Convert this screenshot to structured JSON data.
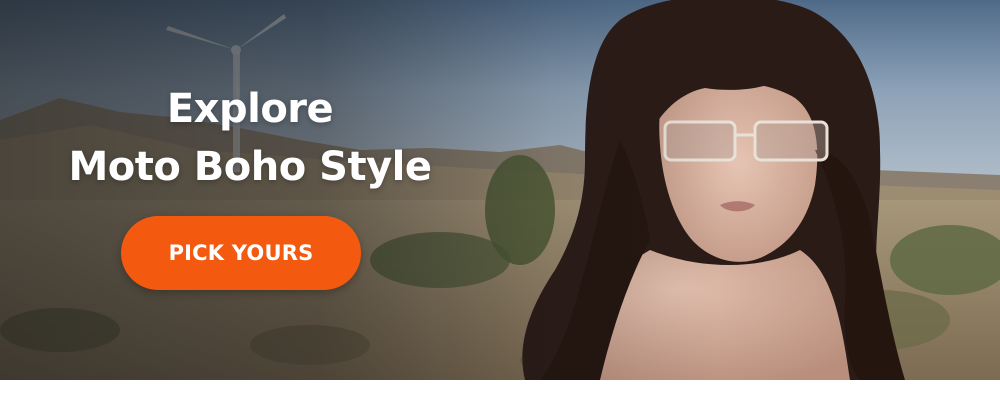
{
  "banner": {
    "headline_line1": "Explore",
    "headline_line2": "Moto Boho Style",
    "cta_label": "PICK YOURS",
    "image_alt": "Woman with long dark wavy hair and rectangular sunglasses in a desert landscape with a wind turbine",
    "colors": {
      "cta_background": "#f35a10",
      "headline": "#ffffff",
      "sky": "#8b9fb3",
      "hair": "#2a1a16",
      "skin": "#d8b3a2"
    }
  }
}
